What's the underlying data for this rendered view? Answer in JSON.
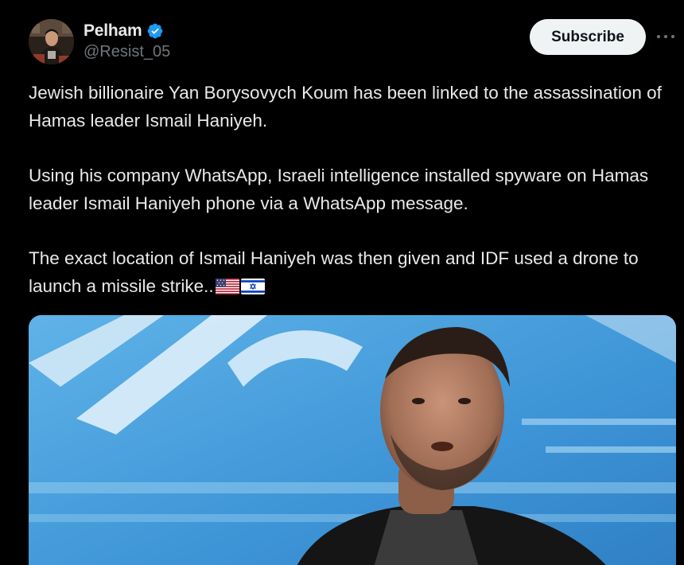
{
  "author": {
    "display_name": "Pelham",
    "handle": "@Resist_05",
    "verified": true
  },
  "actions": {
    "subscribe_label": "Subscribe",
    "more_icon": "more-horizontal-icon"
  },
  "post": {
    "paragraphs": [
      "Jewish billionaire Yan Borysovych Koum has been linked to the assassination of Hamas leader Ismail Haniyeh.",
      "Using his company WhatsApp, Israeli intelligence installed spyware on Hamas leader Ismail Haniyeh phone via a WhatsApp message.",
      "The exact location of Ismail Haniyeh was then given and IDF used a drone to launch a missile strike.."
    ],
    "emoji": [
      "flag-us-icon",
      "flag-israel-icon"
    ]
  },
  "colors": {
    "background": "#000000",
    "text": "#e7e9ea",
    "secondary_text": "#71767b",
    "verified_badge": "#1d9bf0",
    "subscribe_bg": "#eff3f4",
    "subscribe_text": "#0f1419"
  }
}
